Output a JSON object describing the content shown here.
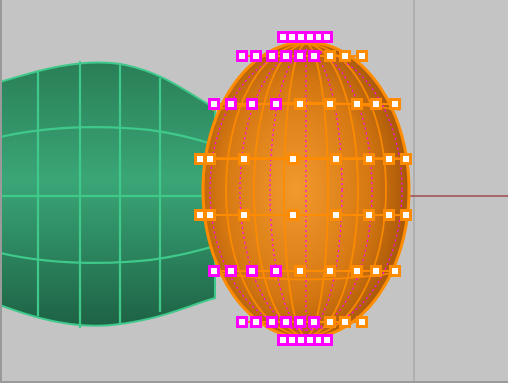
{
  "viewport": {
    "background": "#c4c4c4",
    "grid_line_color": "#a0a0a0",
    "x_axis_color": "#a04848"
  },
  "surfaces": {
    "revolved_body": {
      "name": "green-surface",
      "fill": "#2f8f62",
      "isocurve_color": "#3fc98a"
    },
    "selected_ellipsoid": {
      "name": "orange-surface",
      "fill": "#d97a10",
      "edge_color": "#ff8c00"
    }
  },
  "control_points": {
    "selected_grip_color": "#ff00ff",
    "grip_color": "#ff8c00",
    "grip_fill": "#ffffff"
  }
}
